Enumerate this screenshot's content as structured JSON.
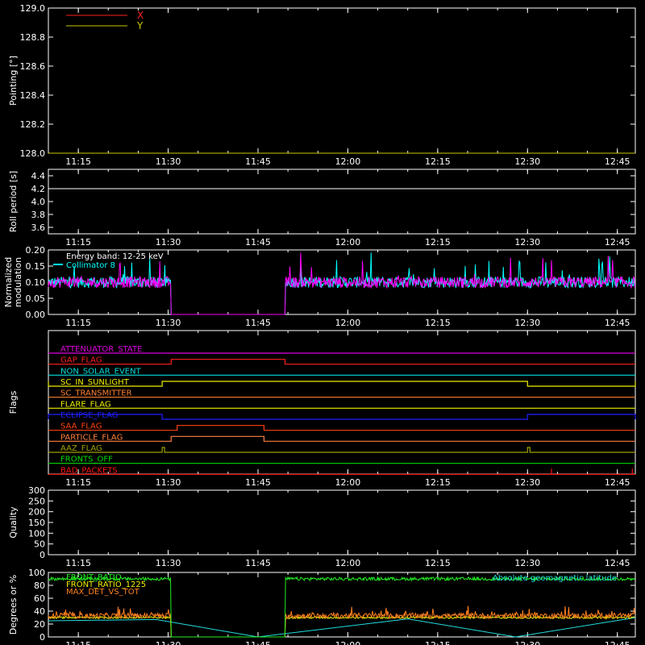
{
  "x_ticks": [
    "11:15",
    "11:30",
    "11:45",
    "12:00",
    "12:15",
    "12:30",
    "12:45"
  ],
  "x_tick_minutes": [
    15,
    30,
    45,
    60,
    75,
    90,
    105
  ],
  "x_range_minutes": [
    10,
    108
  ],
  "chart_data": [
    {
      "type": "line",
      "id": "pointing",
      "ylabel": "Pointing [°]",
      "ylim": [
        128.0,
        129.0
      ],
      "yticks": [
        "128.0",
        "128.2",
        "128.4",
        "128.6",
        "128.8",
        "129.0"
      ],
      "series": [
        {
          "name": "X",
          "color": "#ff2020",
          "x": [
            10,
            108
          ],
          "y": [
            128.0,
            128.0
          ]
        },
        {
          "name": "Y",
          "color": "#c8c800",
          "x": [
            10,
            108
          ],
          "y": [
            128.0,
            128.0
          ]
        }
      ]
    },
    {
      "type": "line",
      "id": "roll",
      "ylabel": "Roll period [s]",
      "ylim": [
        3.5,
        4.5
      ],
      "yticks": [
        "3.6",
        "3.8",
        "4.0",
        "4.2",
        "4.4"
      ],
      "series": [
        {
          "color": "#ffffff",
          "x": [
            10,
            108
          ],
          "y": [
            4.2,
            4.2
          ]
        }
      ]
    },
    {
      "type": "line",
      "id": "modulation",
      "ylabel": [
        "Normalized",
        "modulation"
      ],
      "ylim": [
        0.0,
        0.2
      ],
      "yticks": [
        "0.00",
        "0.05",
        "0.10",
        "0.15",
        "0.20"
      ],
      "annotations": [
        "Energy band: 12-25 keV",
        "Collimator 8"
      ],
      "gap_minutes": [
        30.5,
        49.5
      ],
      "series": [
        {
          "name": "Collimator 8",
          "color": "#00ffff",
          "base": 0.1
        },
        {
          "color": "#ff00ff",
          "base": 0.1
        }
      ]
    },
    {
      "type": "line",
      "id": "flags",
      "ylabel": "Flags",
      "flags": [
        {
          "label": "ATTENUATOR_STATE",
          "color": "#dd00dd",
          "high": []
        },
        {
          "label": "GAP_FLAG",
          "color": "#ff2020",
          "high": [
            [
              30.5,
              49.5
            ]
          ]
        },
        {
          "label": "NON_SOLAR_EVENT",
          "color": "#00dddd",
          "high": []
        },
        {
          "label": "SC_IN_SUNLIGHT",
          "color": "#eeee00",
          "high": [
            [
              10,
              29
            ],
            [
              90,
              108
            ]
          ],
          "inverted": true
        },
        {
          "label": "SC_TRANSMITTER",
          "color": "#ff7f30",
          "high": []
        },
        {
          "label": "FLARE_FLAG",
          "color": "#eeee00",
          "high": []
        },
        {
          "label": "ECLIPSE_FLAG",
          "color": "#2020ff",
          "high": [
            [
              10,
              29
            ],
            [
              90,
              108
            ]
          ]
        },
        {
          "label": "SAA_FLAG",
          "color": "#ff4010",
          "high": [
            [
              31.5,
              46
            ]
          ]
        },
        {
          "label": "PARTICLE_FLAG",
          "color": "#ff8040",
          "high": [
            [
              30.5,
              46
            ]
          ]
        },
        {
          "label": "AAZ_FLAG",
          "color": "#a0a000",
          "high": [
            [
              29,
              29.4
            ],
            [
              90,
              90.4
            ]
          ]
        },
        {
          "label": "FRONTS_OFF",
          "color": "#00dd00",
          "high": []
        },
        {
          "label": "BAD_PACKETS",
          "color": "#ff1010",
          "high": [
            [
              94,
              94.2
            ],
            [
              107.5,
              107.7
            ]
          ],
          "spikes": true
        }
      ]
    },
    {
      "type": "line",
      "id": "quality",
      "ylabel": "Quality",
      "ylim": [
        0,
        300
      ],
      "yticks": [
        "0",
        "50",
        "100",
        "150",
        "200",
        "250",
        "300"
      ],
      "series": []
    },
    {
      "type": "line",
      "id": "front",
      "ylabel": "Degrees or %",
      "ylim": [
        0,
        100
      ],
      "yticks": [
        "0",
        "20",
        "40",
        "60",
        "80",
        "100"
      ],
      "gap_minutes": [
        30.5,
        49.5
      ],
      "series": [
        {
          "name": "FRONT_RATIO",
          "color": "#22ee22",
          "base": 90
        },
        {
          "name": "FRONT_RATIO_1225",
          "color": "#eeee00",
          "base": 30
        },
        {
          "name": "MAX_DET_VS_TOT",
          "color": "#ff8020",
          "base": 33
        },
        {
          "name": "Absolute geomagnetic latitude",
          "color": "#22dddd",
          "x": [
            10,
            28,
            45,
            70,
            88,
            108
          ],
          "y": [
            25,
            27,
            0,
            28,
            0,
            30
          ]
        }
      ]
    }
  ]
}
